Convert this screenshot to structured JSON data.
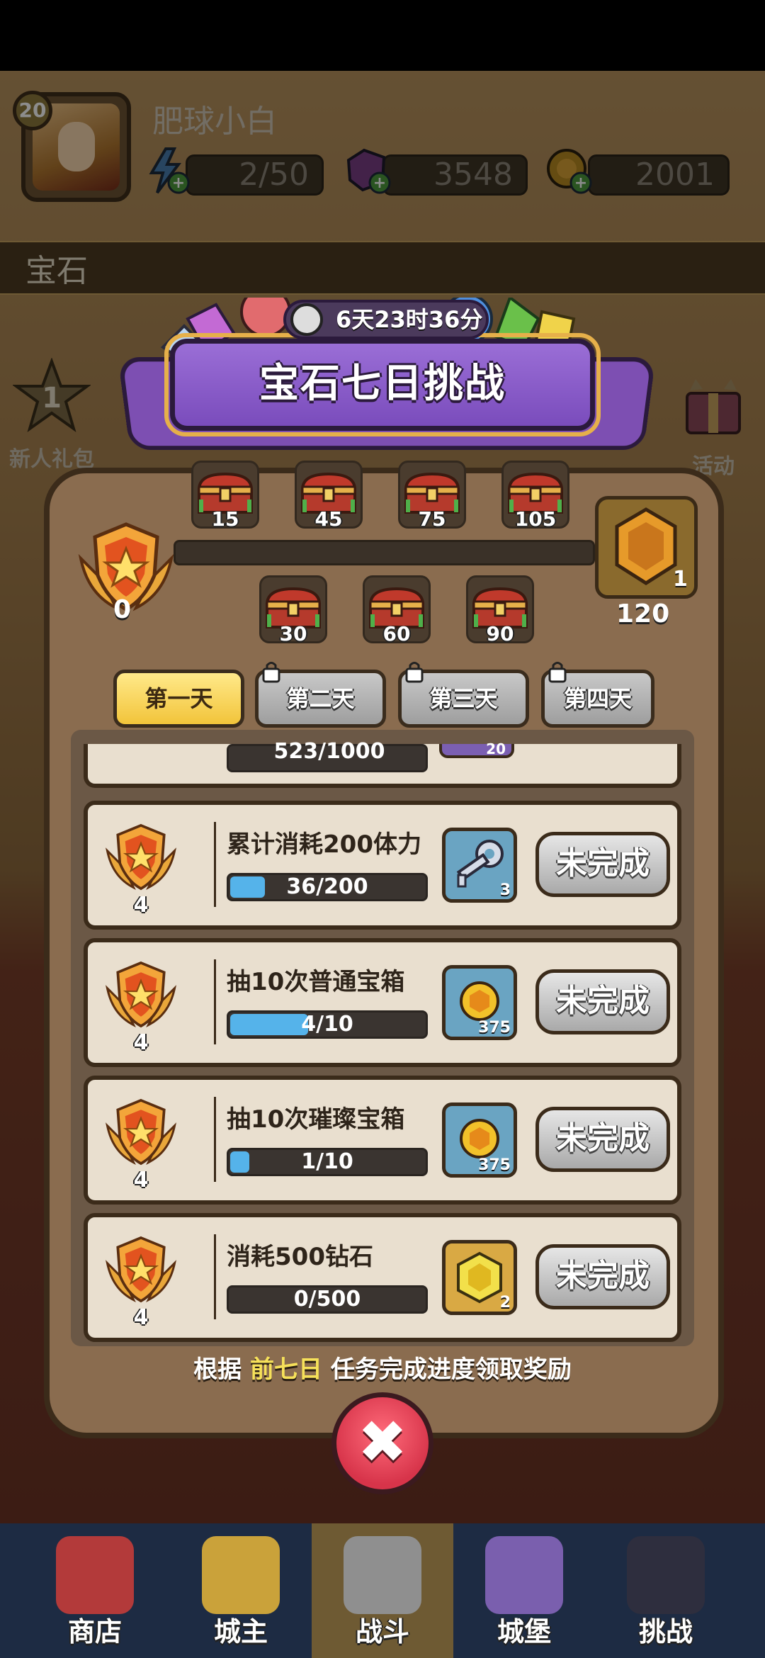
{
  "player": {
    "level": "20",
    "name": "肥球小白"
  },
  "resources": {
    "energy": "2/50",
    "gems": "3548",
    "coins": "2001"
  },
  "ribbon_label": "宝石",
  "side_buttons": {
    "newbie_pack": "新人礼包",
    "newbie_count": "1",
    "activity": "活动"
  },
  "dialog": {
    "timer": "6天23时36分",
    "title": "宝石七日挑战",
    "progress": {
      "current": "0",
      "value_fraction": 0,
      "max_label": "120",
      "final_reward_count": "1",
      "top_chests": [
        "15",
        "45",
        "75",
        "105"
      ],
      "bottom_chests": [
        "30",
        "60",
        "90"
      ]
    },
    "days": [
      {
        "label": "第一天",
        "state": "active"
      },
      {
        "label": "第二天",
        "state": "locked"
      },
      {
        "label": "第三天",
        "state": "locked"
      },
      {
        "label": "第四天",
        "state": "locked"
      }
    ],
    "partial_task": {
      "progress": "523/1000",
      "reward_count": "20"
    },
    "tasks": [
      {
        "title": "累计消耗200体力",
        "progress": "36/200",
        "fraction": 0.18,
        "medal": "4",
        "reward_icon": "key-icon",
        "reward_count": "3",
        "reward_color": "blue",
        "status": "未完成"
      },
      {
        "title": "抽10次普通宝箱",
        "progress": "4/10",
        "fraction": 0.4,
        "medal": "4",
        "reward_icon": "coin-icon",
        "reward_count": "375",
        "reward_color": "blue",
        "status": "未完成"
      },
      {
        "title": "抽10次璀璨宝箱",
        "progress": "1/10",
        "fraction": 0.1,
        "medal": "4",
        "reward_icon": "coin-icon",
        "reward_count": "375",
        "reward_color": "blue",
        "status": "未完成"
      },
      {
        "title": "消耗500钻石",
        "progress": "0/500",
        "fraction": 0,
        "medal": "4",
        "reward_icon": "gem-icon",
        "reward_count": "2",
        "reward_color": "gold",
        "status": "未完成"
      }
    ],
    "footer": {
      "prefix": "根据",
      "highlight": "前七日",
      "suffix": "任务完成进度领取奖励"
    },
    "close_icon": "close-icon"
  },
  "bottom_nav": [
    {
      "label": "商店",
      "icon": "shop-icon"
    },
    {
      "label": "城主",
      "icon": "crown-icon"
    },
    {
      "label": "战斗",
      "icon": "swords-icon"
    },
    {
      "label": "城堡",
      "icon": "castle-icon"
    },
    {
      "label": "挑战",
      "icon": "challenge-icon"
    }
  ],
  "colors": {
    "accent_purple": "#8a5cc8",
    "progress_blue": "#55b3ea",
    "close_red": "#d7344a",
    "highlight_yellow": "#f6e15a"
  }
}
